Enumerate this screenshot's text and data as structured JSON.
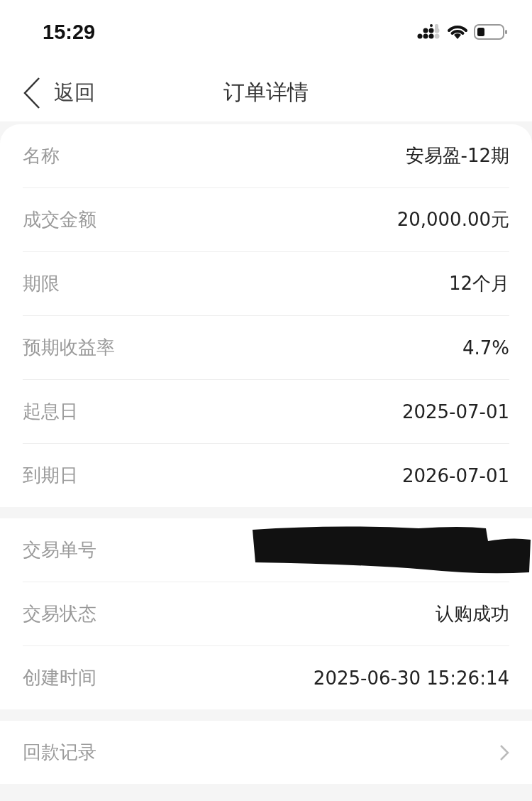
{
  "status_bar": {
    "time": "15:29"
  },
  "nav": {
    "back": "返回",
    "title": "订单详情"
  },
  "sections": [
    {
      "rows": [
        {
          "label": "名称",
          "value": "安易盈-12期",
          "kind": "text"
        },
        {
          "label": "成交金额",
          "value": "20,000.00元",
          "kind": "text"
        },
        {
          "label": "期限",
          "value": "12个月",
          "kind": "text"
        },
        {
          "label": "预期收益率",
          "value": "4.7%",
          "kind": "text"
        },
        {
          "label": "起息日",
          "value": "2025-07-01",
          "kind": "text"
        },
        {
          "label": "到期日",
          "value": "2026-07-01",
          "kind": "text"
        }
      ]
    },
    {
      "rows": [
        {
          "label": "交易单号",
          "kind": "redacted"
        },
        {
          "label": "交易状态",
          "value": "认购成功",
          "kind": "text"
        },
        {
          "label": "创建时间",
          "value": "2025-06-30 15:26:14",
          "kind": "text"
        }
      ]
    },
    {
      "rows": [
        {
          "label": "回款记录",
          "kind": "link"
        }
      ]
    }
  ]
}
